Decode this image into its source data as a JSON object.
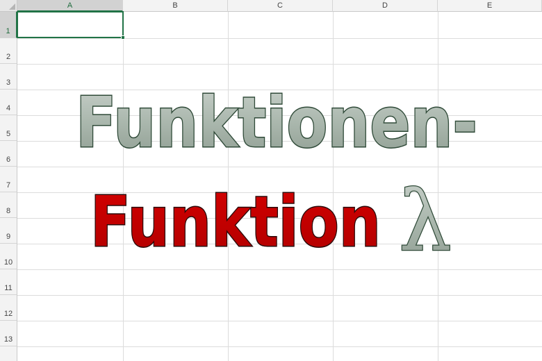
{
  "sheet": {
    "columns": [
      "A",
      "B",
      "C",
      "D",
      "E"
    ],
    "rows": [
      "1",
      "2",
      "3",
      "4",
      "5",
      "6",
      "7",
      "8",
      "9",
      "10",
      "11",
      "12",
      "13"
    ],
    "active_cell": "A1",
    "colors": {
      "accent": "#217346",
      "grid": "#dcdcdc",
      "header_bg": "#f3f3f3"
    }
  },
  "wordart": {
    "line1": "Funktionen-",
    "line2": "Funktion",
    "lambda": "λ",
    "colors": {
      "line1_fill": "#aab7ad",
      "line1_outline": "#2f4a38",
      "line2_fill": "#c00000",
      "line2_outline": "#2a0a0a",
      "lambda_fill": "#aab7ad",
      "lambda_outline": "#2f4a38"
    }
  }
}
